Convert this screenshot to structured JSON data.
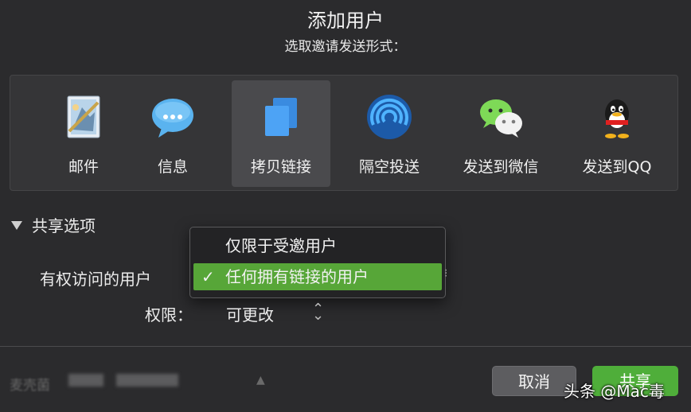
{
  "dialog": {
    "title": "添加用户",
    "subtitle": "选取邀请发送形式："
  },
  "share_methods": [
    {
      "label": "邮件",
      "icon": "mail-icon"
    },
    {
      "label": "信息",
      "icon": "messages-icon"
    },
    {
      "label": "拷贝链接",
      "icon": "copy-link-icon",
      "selected": true
    },
    {
      "label": "隔空投送",
      "icon": "airdrop-icon"
    },
    {
      "label": "发送到微信",
      "icon": "wechat-icon"
    },
    {
      "label": "发送到QQ",
      "icon": "qq-icon"
    }
  ],
  "share_options": {
    "header": "共享选项",
    "access_label": "有权访问的用户",
    "access_dropdown": {
      "options": [
        "仅限于受邀用户",
        "任何拥有链接的用户"
      ],
      "selected_index": 1,
      "check_mark": "✓"
    },
    "permission_label": "权限：",
    "permission_value": "可更改"
  },
  "footer": {
    "user_name": "麦壳菌",
    "cancel_label": "取消",
    "share_label": "共享"
  },
  "watermark": "头条 @Mac毒",
  "colors": {
    "background": "#2b2b2d",
    "accent_green": "#57a638",
    "selected_tile": "#4a4a4d"
  }
}
